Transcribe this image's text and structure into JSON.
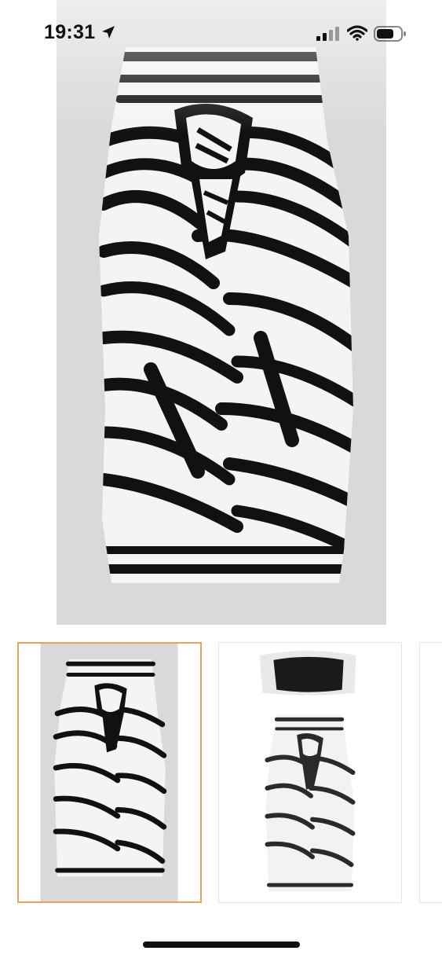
{
  "status_bar": {
    "time": "19:31",
    "icons": [
      "location-arrow-icon",
      "cellular-signal-icon",
      "wifi-icon",
      "battery-icon"
    ]
  },
  "viewer": {
    "close_icon": "close-icon",
    "main_image": "zebra-print-sarong-wrap",
    "thumbnails": [
      {
        "image": "zebra-print-sarong-wrap",
        "selected": true
      },
      {
        "image": "black-bandeau-top-with-zebra-sarong",
        "selected": false
      },
      {
        "image": "partial-next-thumbnail",
        "selected": false
      }
    ]
  },
  "colors": {
    "selected_border": "#e8a35a",
    "image_background": "#d9d9d9",
    "print_black": "#111111",
    "print_white": "#f4f4f4"
  }
}
